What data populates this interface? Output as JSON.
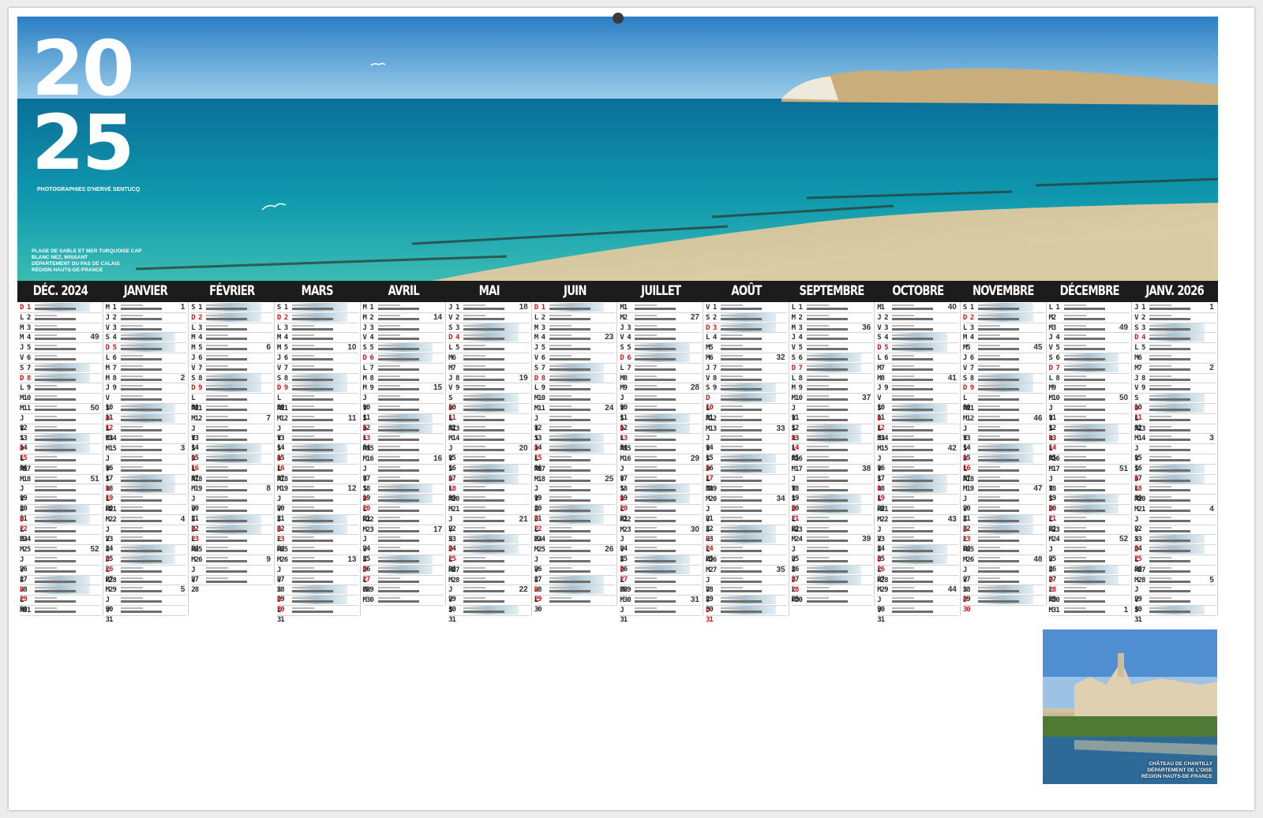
{
  "year_lines": [
    "20",
    "25"
  ],
  "photo_credit": "PHOTOGRAPHIES D'HERVÉ SENTUCQ",
  "main_caption": [
    "PLAGE DE SABLE ET MER TURQUOISE CAP",
    "BLANC NEZ, WISSANT",
    "DÉPARTEMENT DU PAS DE CALAIS",
    "RÉGION HAUTS-DE-FRANCE"
  ],
  "thumb_caption": [
    "CHÂTEAU DE CHANTILLY",
    "DÉPARTEMENT DE L'OISE",
    "RÉGION HAUTS-DE-FRANCE"
  ],
  "colors": {
    "header": "#1c1c1c",
    "sunday": "#d0161a",
    "highlight": "#a9c4d3"
  },
  "months": [
    {
      "name": "DÉC. 2024",
      "days": [
        "D 1",
        "L 2",
        "M 3",
        "M 4",
        "J 5",
        "V 6",
        "S 7",
        "D 8",
        "L 9",
        "M10",
        "M11",
        "J 12",
        "V 13",
        "S 14",
        "D 15",
        "L 16",
        "M17",
        "M18",
        "J 19",
        "V 20",
        "S 21",
        "D 22",
        "L 23",
        "M24",
        "M25",
        "J 26",
        "V 27",
        "S 28",
        "D 29",
        "L 30",
        "M31"
      ],
      "weeks": {
        "4": "49",
        "11": "50",
        "18": "51",
        "25": "52"
      }
    },
    {
      "name": "JANVIER",
      "days": [
        "M 1",
        "J 2",
        "V 3",
        "S 4",
        "D 5",
        "L 6",
        "M 7",
        "M 8",
        "J 9",
        "V 10",
        "S 11",
        "D 12",
        "L 13",
        "M14",
        "M15",
        "J 16",
        "V 17",
        "S 18",
        "D 19",
        "L 20",
        "M21",
        "M22",
        "J 23",
        "V 24",
        "S 25",
        "D 26",
        "L 27",
        "M28",
        "M29",
        "J 30",
        "V 31"
      ],
      "weeks": {
        "1": "1",
        "8": "2",
        "15": "3",
        "22": "4",
        "29": "5"
      }
    },
    {
      "name": "FÉVRIER",
      "days": [
        "S 1",
        "D 2",
        "L 3",
        "M 4",
        "M 5",
        "J 6",
        "V 7",
        "S 8",
        "D 9",
        "L 10",
        "M11",
        "M12",
        "J 13",
        "V 14",
        "S 15",
        "D 16",
        "L 17",
        "M18",
        "M19",
        "J 20",
        "V 21",
        "S 22",
        "D 23",
        "L 24",
        "M25",
        "M26",
        "J 27",
        "V 28"
      ],
      "weeks": {
        "5": "6",
        "12": "7",
        "19": "8",
        "26": "9"
      }
    },
    {
      "name": "MARS",
      "days": [
        "S 1",
        "D 2",
        "L 3",
        "M 4",
        "M 5",
        "J 6",
        "V 7",
        "S 8",
        "D 9",
        "L 10",
        "M11",
        "M12",
        "J 13",
        "V 14",
        "S 15",
        "D 16",
        "L 17",
        "M18",
        "M19",
        "J 20",
        "V 21",
        "S 22",
        "D 23",
        "L 24",
        "M25",
        "M26",
        "J 27",
        "V 28",
        "S 29",
        "D 30",
        "L 31"
      ],
      "weeks": {
        "5": "10",
        "12": "11",
        "19": "12",
        "26": "13"
      }
    },
    {
      "name": "AVRIL",
      "days": [
        "M 1",
        "M 2",
        "J 3",
        "V 4",
        "S 5",
        "D 6",
        "L 7",
        "M 8",
        "M 9",
        "J 10",
        "V 11",
        "S 12",
        "D 13",
        "L 14",
        "M15",
        "M16",
        "J 17",
        "V 18",
        "S 19",
        "D 20",
        "L 21",
        "M22",
        "M23",
        "J 24",
        "V 25",
        "S 26",
        "D 27",
        "L 28",
        "M29",
        "M30"
      ],
      "weeks": {
        "2": "14",
        "9": "15",
        "16": "16",
        "23": "17"
      }
    },
    {
      "name": "MAI",
      "days": [
        "J 1",
        "V 2",
        "S 3",
        "D 4",
        "L 5",
        "M6",
        "M7",
        "J 8",
        "V 9",
        "S 10",
        "D 11",
        "L 12",
        "M13",
        "M14",
        "J 15",
        "V 16",
        "S 17",
        "D 18",
        "L 19",
        "M20",
        "M21",
        "J 22",
        "V 23",
        "S 24",
        "D 25",
        "L 26",
        "M27",
        "M28",
        "J 29",
        "V 30",
        "S 31"
      ],
      "weeks": {
        "1": "18",
        "8": "19",
        "15": "20",
        "22": "21",
        "29": "22"
      }
    },
    {
      "name": "JUIN",
      "days": [
        "D 1",
        "L 2",
        "M 3",
        "M 4",
        "J 5",
        "V 6",
        "S 7",
        "D 8",
        "L 9",
        "M10",
        "M11",
        "J 12",
        "V 13",
        "S 14",
        "D 15",
        "L 16",
        "M17",
        "M18",
        "J 19",
        "V 20",
        "S 21",
        "D 22",
        "L 23",
        "M24",
        "M25",
        "J 26",
        "V 27",
        "S 28",
        "D 29",
        "L 30"
      ],
      "weeks": {
        "4": "23",
        "11": "24",
        "18": "25",
        "25": "26"
      }
    },
    {
      "name": "JUILLET",
      "days": [
        "M1",
        "M2",
        "J 3",
        "V 4",
        "S 5",
        "D 6",
        "L 7",
        "M8",
        "M9",
        "J 10",
        "V 11",
        "S 12",
        "D 13",
        "L 14",
        "M15",
        "M16",
        "J 17",
        "V 18",
        "S 19",
        "D 20",
        "L 21",
        "M22",
        "M23",
        "J 24",
        "V 25",
        "S 26",
        "D 27",
        "L 28",
        "M29",
        "M30",
        "J 31"
      ],
      "weeks": {
        "2": "27",
        "9": "28",
        "16": "29",
        "23": "30",
        "30": "31"
      }
    },
    {
      "name": "AOÛT",
      "days": [
        "V 1",
        "S 2",
        "D 3",
        "L 4",
        "M5",
        "M6",
        "J 7",
        "V 8",
        "S 9",
        "D 10",
        "L 11",
        "M12",
        "M13",
        "J 14",
        "V 15",
        "S 16",
        "D 17",
        "L 18",
        "M19",
        "M20",
        "J 21",
        "V 22",
        "S 23",
        "D 24",
        "L 25",
        "M26",
        "M27",
        "J 28",
        "V 29",
        "S 30",
        "D 31"
      ],
      "weeks": {
        "6": "32",
        "13": "33",
        "20": "34",
        "27": "35"
      }
    },
    {
      "name": "SEPTEMBRE",
      "days": [
        "L 1",
        "M 2",
        "M 3",
        "J 4",
        "V 5",
        "S 6",
        "D 7",
        "L 8",
        "M 9",
        "M10",
        "J 11",
        "V 12",
        "S 13",
        "D 14",
        "L 15",
        "M16",
        "M17",
        "J 18",
        "V 19",
        "S 20",
        "D 21",
        "L 22",
        "M23",
        "M24",
        "J 25",
        "V 26",
        "S 27",
        "D 28",
        "L 29",
        "M30"
      ],
      "weeks": {
        "3": "36",
        "10": "37",
        "17": "38",
        "24": "39"
      }
    },
    {
      "name": "OCTOBRE",
      "days": [
        "M1",
        "J 2",
        "V 3",
        "S 4",
        "D 5",
        "L 6",
        "M7",
        "M8",
        "J 9",
        "V 10",
        "S 11",
        "D 12",
        "L 13",
        "M14",
        "M15",
        "J 16",
        "V 17",
        "S 18",
        "D 19",
        "L 20",
        "M21",
        "M22",
        "J 23",
        "V 24",
        "S 25",
        "D 26",
        "L 27",
        "M28",
        "M29",
        "J 30",
        "V 31"
      ],
      "weeks": {
        "1": "40",
        "8": "41",
        "15": "42",
        "22": "43",
        "29": "44"
      }
    },
    {
      "name": "NOVEMBRE",
      "days": [
        "S 1",
        "D 2",
        "L 3",
        "M 4",
        "M5",
        "J 6",
        "V 7",
        "S 8",
        "D 9",
        "L 10",
        "M11",
        "M12",
        "J 13",
        "V 14",
        "S 15",
        "D 16",
        "L 17",
        "M18",
        "M19",
        "J 20",
        "V 21",
        "S 22",
        "D 23",
        "L 24",
        "M25",
        "M26",
        "J 27",
        "V 28",
        "S 29",
        "D 30"
      ],
      "weeks": {
        "5": "45",
        "12": "46",
        "19": "47",
        "26": "48"
      }
    },
    {
      "name": "DÉCEMBRE",
      "days": [
        "L 1",
        "M2",
        "M3",
        "J 4",
        "V 5",
        "S 6",
        "D 7",
        "L 8",
        "M9",
        "M10",
        "J 11",
        "V 12",
        "S 13",
        "D 14",
        "L 15",
        "M16",
        "M17",
        "J 18",
        "V 19",
        "S 20",
        "D 21",
        "L 22",
        "M23",
        "M24",
        "J 25",
        "V 26",
        "S 27",
        "D 28",
        "L 29",
        "M30",
        "M31"
      ],
      "weeks": {
        "3": "49",
        "10": "50",
        "17": "51",
        "24": "52",
        "31": "1"
      }
    },
    {
      "name": "JANV. 2026",
      "days": [
        "J 1",
        "V 2",
        "S 3",
        "D 4",
        "L 5",
        "M6",
        "M7",
        "J 8",
        "V 9",
        "S 10",
        "D 11",
        "L 12",
        "M13",
        "M14",
        "J 15",
        "V 16",
        "S 17",
        "D 18",
        "L 19",
        "M20",
        "M21",
        "J 22",
        "V 23",
        "S 24",
        "D 25",
        "L 26",
        "M27",
        "M28",
        "J 29",
        "V 30",
        "S 31"
      ],
      "weeks": {
        "1": "1",
        "7": "2",
        "14": "3",
        "21": "4",
        "28": "5"
      }
    }
  ]
}
